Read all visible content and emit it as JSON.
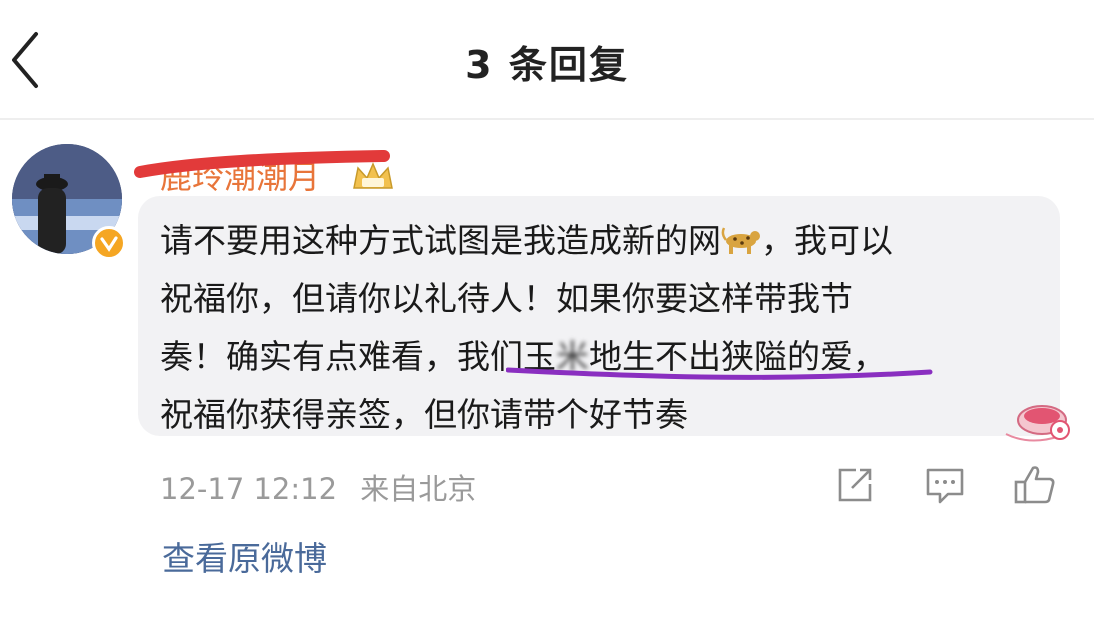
{
  "header": {
    "title": "3 条回复"
  },
  "reply": {
    "username": "鹿玲潮潮月",
    "comment_lines": [
      [
        "请不要用这种方式试图是我造成新的网",
        "，我可以"
      ],
      [
        "祝福你，但请你以礼待人！如果你要这样带我节"
      ],
      [
        "奏！确实有点难看，我们玉",
        "米",
        "地生不出狭隘的爱，"
      ],
      [
        "祝福你获得亲签，但你请带个好节奏"
      ]
    ],
    "timestamp": "12-17 12:12",
    "location": "来自北京",
    "view_original": "查看原微博"
  },
  "icons": {
    "back": "chevron-left-icon",
    "crown": "crown-badge-icon",
    "verified": "verified-badge-icon",
    "leopard": "leopard-emoji-icon",
    "share": "share-icon",
    "comment": "comment-icon",
    "like": "thumbs-up-icon"
  },
  "colors": {
    "username": "#e8753a",
    "redact_stroke": "#e23a3a",
    "underline": "#8a2fc0",
    "link": "#4a6a9a",
    "meta": "#9a9a9a",
    "verified_badge": "#f5a623"
  }
}
